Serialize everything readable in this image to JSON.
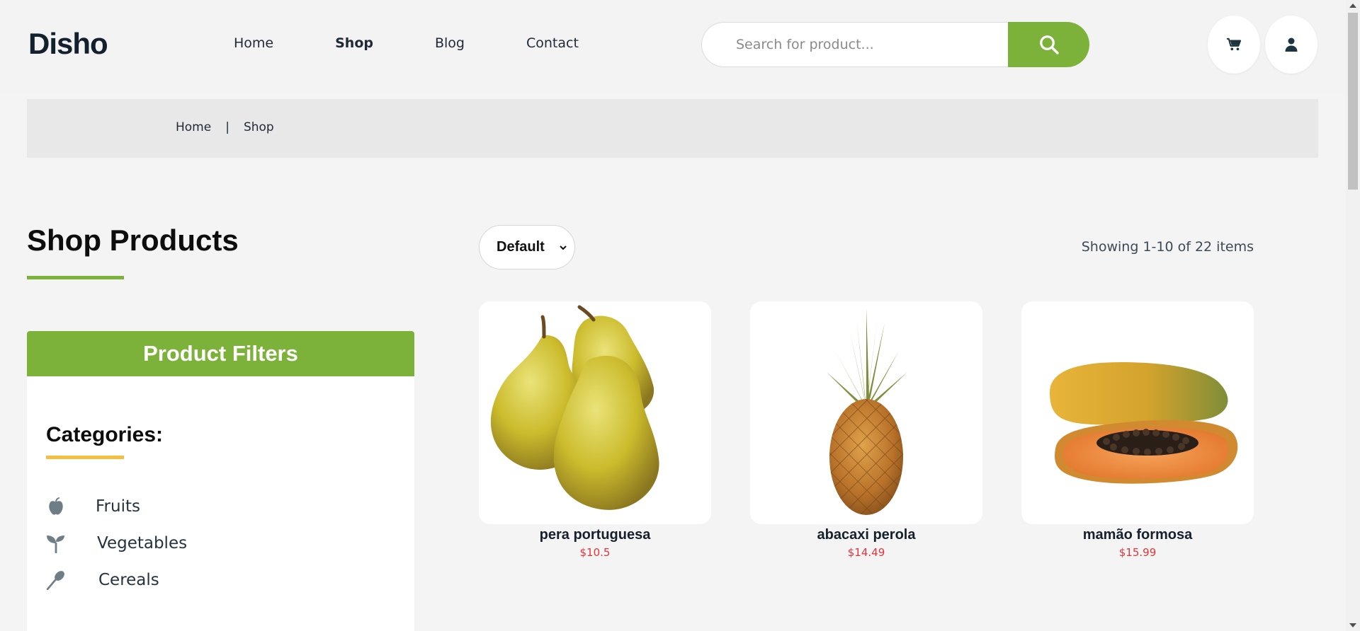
{
  "brand": {
    "logo": "Disho"
  },
  "nav": {
    "home": "Home",
    "shop": "Shop",
    "blog": "Blog",
    "contact": "Contact"
  },
  "search": {
    "placeholder": "Search for product..."
  },
  "breadcrumb": {
    "home": "Home",
    "separator": "|",
    "current": "Shop"
  },
  "page": {
    "title": "Shop Products"
  },
  "filters": {
    "title": "Product Filters",
    "categories_title": "Categories:",
    "categories": [
      {
        "label": "Fruits",
        "icon": "apple-icon"
      },
      {
        "label": "Vegetables",
        "icon": "sprout-icon"
      },
      {
        "label": "Cereals",
        "icon": "wheat-icon"
      }
    ]
  },
  "toolbar": {
    "sort_value": "Default",
    "showing": "Showing 1-10 of 22 items"
  },
  "products": [
    {
      "name": "pera portuguesa",
      "price": "$10.5",
      "image": "pears-image"
    },
    {
      "name": "abacaxi perola",
      "price": "$14.49",
      "image": "pineapple-image"
    },
    {
      "name": "mamão formosa",
      "price": "$15.99",
      "image": "papaya-image"
    }
  ],
  "colors": {
    "accent": "#7db23a",
    "price": "#e0353b",
    "underline_yellow": "#f4bf3d"
  }
}
